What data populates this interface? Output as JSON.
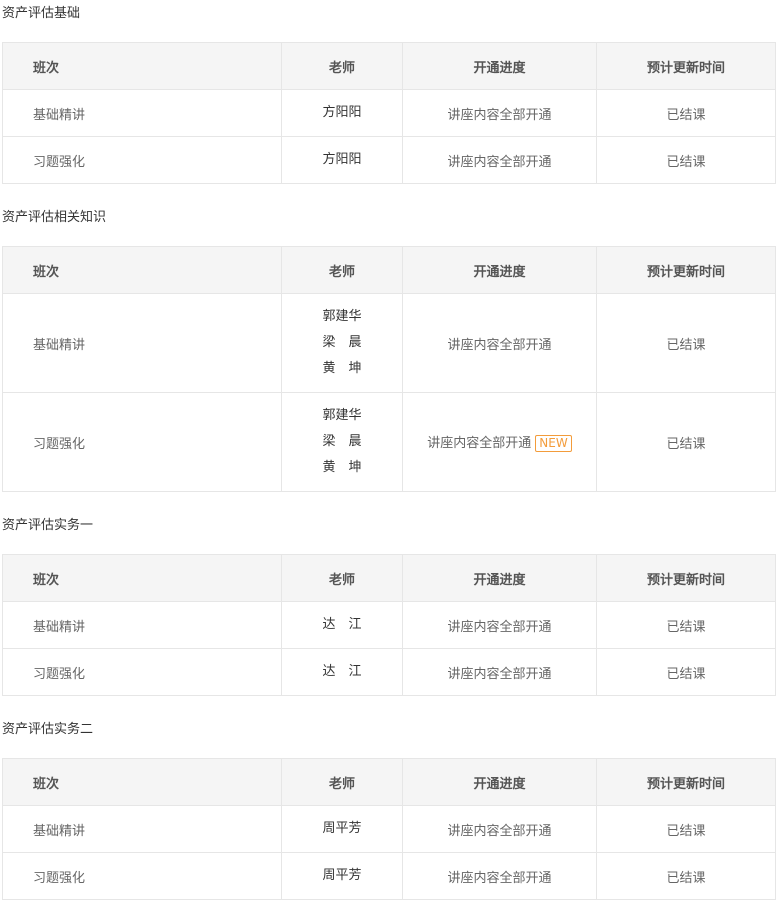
{
  "headers": [
    "班次",
    "老师",
    "开通进度",
    "预计更新时间"
  ],
  "sections": [
    {
      "title": "资产评估基础",
      "rows": [
        {
          "class": "基础精讲",
          "teachers": [
            "方阳阳"
          ],
          "progress": "讲座内容全部开通",
          "new": null,
          "update": "已结课"
        },
        {
          "class": "习题强化",
          "teachers": [
            "方阳阳"
          ],
          "progress": "讲座内容全部开通",
          "new": null,
          "update": "已结课"
        }
      ]
    },
    {
      "title": "资产评估相关知识",
      "rows": [
        {
          "class": "基础精讲",
          "teachers": [
            "郭建华",
            "梁　晨",
            "黄　坤"
          ],
          "progress": "讲座内容全部开通",
          "new": null,
          "update": "已结课"
        },
        {
          "class": "习题强化",
          "teachers": [
            "郭建华",
            "梁　晨",
            "黄　坤"
          ],
          "progress": "讲座内容全部开通",
          "new": "NEW",
          "update": "已结课"
        }
      ]
    },
    {
      "title": "资产评估实务一",
      "rows": [
        {
          "class": "基础精讲",
          "teachers": [
            "达　江"
          ],
          "progress": "讲座内容全部开通",
          "new": null,
          "update": "已结课"
        },
        {
          "class": "习题强化",
          "teachers": [
            "达　江"
          ],
          "progress": "讲座内容全部开通",
          "new": null,
          "update": "已结课"
        }
      ]
    },
    {
      "title": "资产评估实务二",
      "rows": [
        {
          "class": "基础精讲",
          "teachers": [
            "周平芳"
          ],
          "progress": "讲座内容全部开通",
          "new": null,
          "update": "已结课"
        },
        {
          "class": "习题强化",
          "teachers": [
            "周平芳"
          ],
          "progress": "讲座内容全部开通",
          "new": null,
          "update": "已结课"
        }
      ]
    }
  ],
  "colors": {
    "badge": "#f39c3b",
    "header_bg": "#f5f5f5",
    "border": "#e6e6e6"
  }
}
